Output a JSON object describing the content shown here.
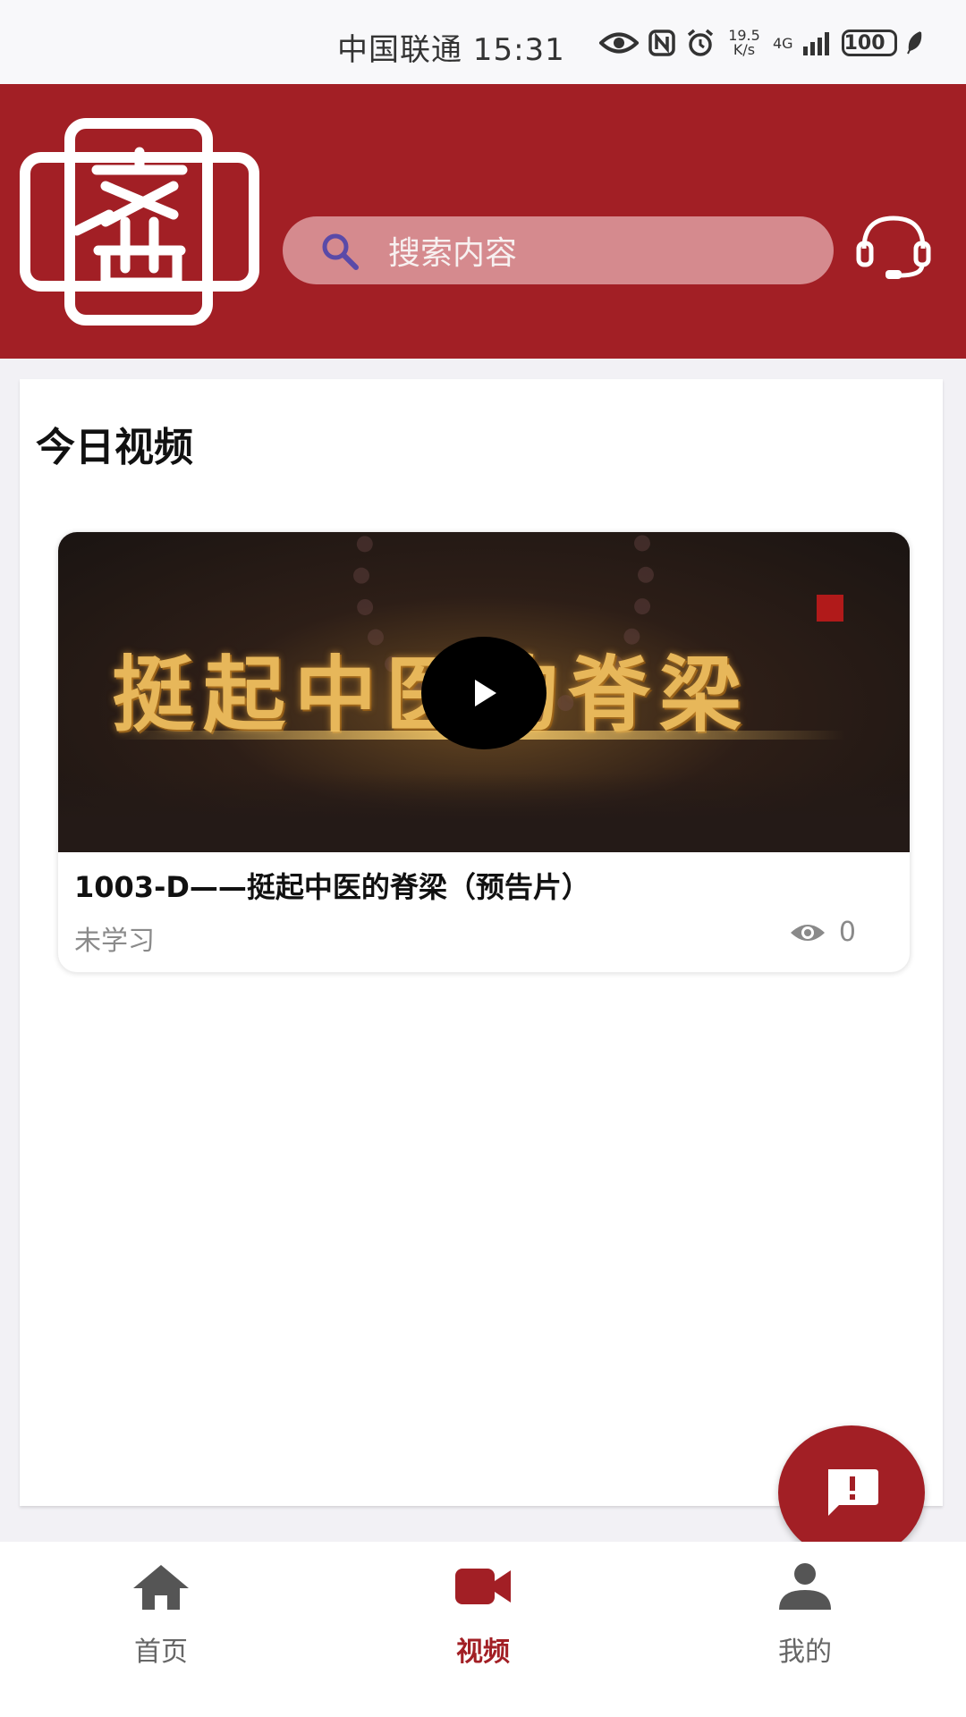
{
  "status_bar": {
    "carrier_time": "中国联通 15:31",
    "speed": "19.5\nK/s",
    "network": "4G",
    "battery": "100"
  },
  "header": {
    "logo_text": "济世",
    "search_placeholder": "搜索内容",
    "colors": {
      "brand": "#a21f25",
      "search_bg": "#d58a8e"
    }
  },
  "content": {
    "section_title": "今日视频",
    "video": {
      "thumbnail_text": "挺起中医的脊梁",
      "title": "1003-D——挺起中医的脊梁（预告片）",
      "status": "未学习",
      "views": "0"
    }
  },
  "bottom_nav": {
    "items": [
      {
        "label": "首页",
        "icon": "home-icon",
        "active": false
      },
      {
        "label": "视频",
        "icon": "video-camera-icon",
        "active": true
      },
      {
        "label": "我的",
        "icon": "person-icon",
        "active": false
      }
    ]
  }
}
